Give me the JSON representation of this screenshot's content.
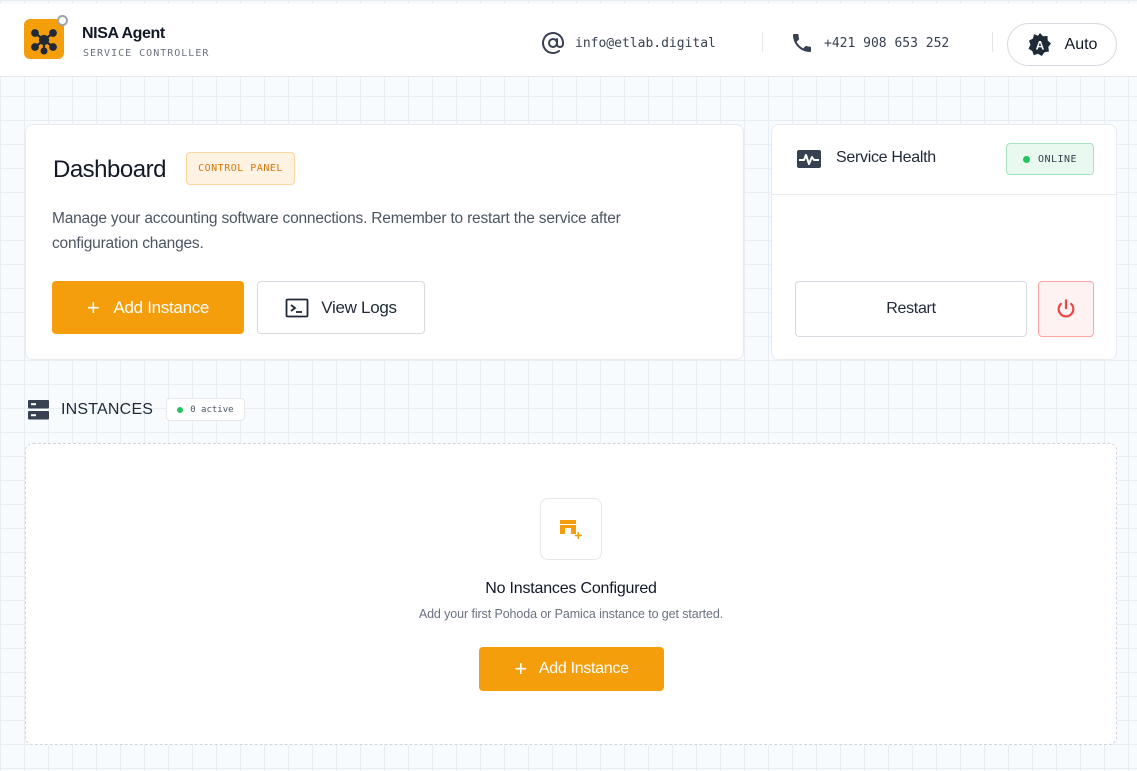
{
  "header": {
    "brand_name": "NISA Agent",
    "brand_sub": "SERVICE CONTROLLER",
    "email": "info@etlab.digital",
    "phone": "+421 908 653 252",
    "theme_label": "Auto",
    "theme_icon_letter": "A"
  },
  "dashboard": {
    "title": "Dashboard",
    "badge": "CONTROL PANEL",
    "description": "Manage your accounting software connections. Remember to restart the service after configuration changes.",
    "add_button": "Add Instance",
    "logs_button": "View Logs"
  },
  "health": {
    "title": "Service Health",
    "status": "ONLINE",
    "restart_button": "Restart"
  },
  "instances": {
    "label": "INSTANCES",
    "active_badge": "0 active",
    "empty_title": "No Instances Configured",
    "empty_subtitle": "Add your first Pohoda or Pamica instance to get started.",
    "add_button": "Add Instance"
  },
  "colors": {
    "accent": "#f59e0b",
    "online": "#22c55e",
    "danger": "#ef4444"
  },
  "icons": {
    "logo": "network-nodes-icon",
    "email": "at-sign-icon",
    "phone": "phone-icon",
    "theme": "auto-theme-icon",
    "logs": "terminal-icon",
    "health": "activity-icon",
    "power": "power-icon",
    "instances": "server-icon",
    "empty": "store-add-icon"
  }
}
